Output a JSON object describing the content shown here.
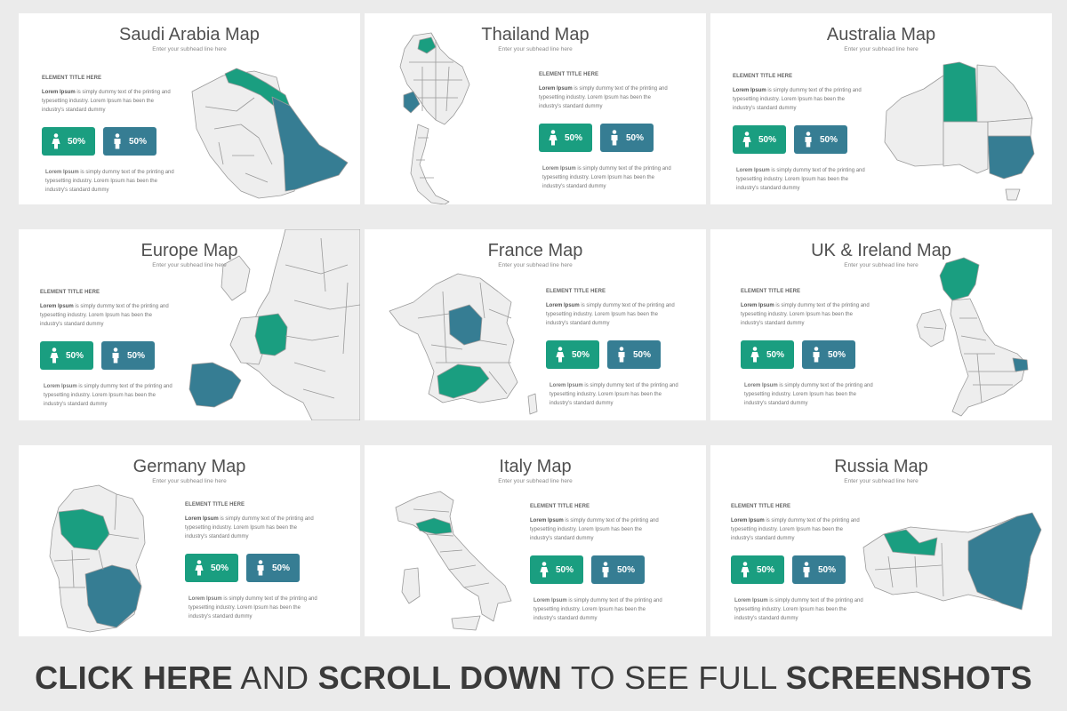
{
  "cards": [
    {
      "title": "Saudi Arabia Map",
      "subtitle": "Enter your subhead line here",
      "element_title": "ELEMENT TITLE HERE",
      "body_lead": "Lorem Ipsum",
      "body_rest": " is simply dummy text of the printing and typesetting industry. Lorem Ipsum has been the industry's standard dummy",
      "stat_female": "50%",
      "stat_male": "50%",
      "bottom_lead": "Lorem Ipsum",
      "bottom_rest": " is simply dummy text of the printing and typesetting industry. Lorem Ipsum has been the industry's standard dummy"
    },
    {
      "title": "Thailand Map",
      "subtitle": "Enter your subhead line here",
      "element_title": "ELEMENT TITLE HERE",
      "body_lead": "Lorem Ipsum",
      "body_rest": " is simply dummy text of the printing and typesetting industry. Lorem Ipsum has been the industry's standard dummy",
      "stat_female": "50%",
      "stat_male": "50%",
      "bottom_lead": "Lorem Ipsum",
      "bottom_rest": " is simply dummy text of the printing and typesetting industry. Lorem Ipsum has been the industry's standard dummy"
    },
    {
      "title": "Australia Map",
      "subtitle": "Enter your subhead line here",
      "element_title": "ELEMENT TITLE HERE",
      "body_lead": "Lorem Ipsum",
      "body_rest": " is simply dummy text of the printing and typesetting industry. Lorem Ipsum has been the industry's standard dummy",
      "stat_female": "50%",
      "stat_male": "50%",
      "bottom_lead": "Lorem Ipsum",
      "bottom_rest": " is simply dummy text of the printing and typesetting industry. Lorem Ipsum has been the industry's standard dummy"
    },
    {
      "title": "Europe Map",
      "subtitle": "Enter your subhead line here",
      "element_title": "ELEMENT TITLE HERE",
      "body_lead": "Lorem Ipsum",
      "body_rest": " is simply dummy text of the printing and typesetting industry. Lorem Ipsum has been the industry's standard dummy",
      "stat_female": "50%",
      "stat_male": "50%",
      "bottom_lead": "Lorem Ipsum",
      "bottom_rest": " is simply dummy text of the printing and typesetting industry. Lorem Ipsum has been the industry's standard dummy"
    },
    {
      "title": "France Map",
      "subtitle": "Enter your subhead line here",
      "element_title": "ELEMENT TITLE HERE",
      "body_lead": "Lorem Ipsum",
      "body_rest": " is simply dummy text of the printing and typesetting industry. Lorem Ipsum has been the industry's standard dummy",
      "stat_female": "50%",
      "stat_male": "50%",
      "bottom_lead": "Lorem Ipsum",
      "bottom_rest": " is simply dummy text of the printing and typesetting industry. Lorem Ipsum has been the industry's standard dummy"
    },
    {
      "title": "UK & Ireland Map",
      "subtitle": "Enter your subhead line here",
      "element_title": "ELEMENT TITLE HERE",
      "body_lead": "Lorem Ipsum",
      "body_rest": " is simply dummy text of the printing and typesetting industry. Lorem Ipsum has been the industry's standard dummy",
      "stat_female": "50%",
      "stat_male": "50%",
      "bottom_lead": "Lorem Ipsum",
      "bottom_rest": " is simply dummy text of the printing and typesetting industry. Lorem Ipsum has been the industry's standard dummy"
    },
    {
      "title": "Germany Map",
      "subtitle": "Enter your subhead line here",
      "element_title": "ELEMENT TITLE HERE",
      "body_lead": "Lorem Ipsum",
      "body_rest": " is simply dummy text of the printing and typesetting industry. Lorem Ipsum has been the industry's standard dummy",
      "stat_female": "50%",
      "stat_male": "50%",
      "bottom_lead": "Lorem Ipsum",
      "bottom_rest": " is simply dummy text of the printing and typesetting industry. Lorem Ipsum has been the industry's standard dummy"
    },
    {
      "title": "Italy Map",
      "subtitle": "Enter your subhead line here",
      "element_title": "ELEMENT TITLE HERE",
      "body_lead": "Lorem Ipsum",
      "body_rest": " is simply dummy text of the printing and typesetting industry. Lorem Ipsum has been the industry's standard dummy",
      "stat_female": "50%",
      "stat_male": "50%",
      "bottom_lead": "Lorem Ipsum",
      "bottom_rest": " is simply dummy text of the printing and typesetting industry. Lorem Ipsum has been the industry's standard dummy"
    },
    {
      "title": "Russia Map",
      "subtitle": "Enter your subhead line here",
      "element_title": "ELEMENT TITLE HERE",
      "body_lead": "Lorem Ipsum",
      "body_rest": " is simply dummy text of the printing and typesetting industry. Lorem Ipsum has been the industry's standard dummy",
      "stat_female": "50%",
      "stat_male": "50%",
      "bottom_lead": "Lorem Ipsum",
      "bottom_rest": " is simply dummy text of the printing and typesetting industry. Lorem Ipsum has been the industry's standard dummy"
    }
  ],
  "cta": {
    "part1": "CLICK HERE",
    "part2": " AND ",
    "part3": "SCROLL DOWN",
    "part4": " TO SEE FULL ",
    "part5": "SCREENSHOTS"
  },
  "colors": {
    "green": "#1a9e80",
    "blue": "#367d93",
    "background": "#ebebeb",
    "card": "#ffffff"
  },
  "icons": {
    "female": "female-person-icon",
    "male": "male-person-icon"
  }
}
